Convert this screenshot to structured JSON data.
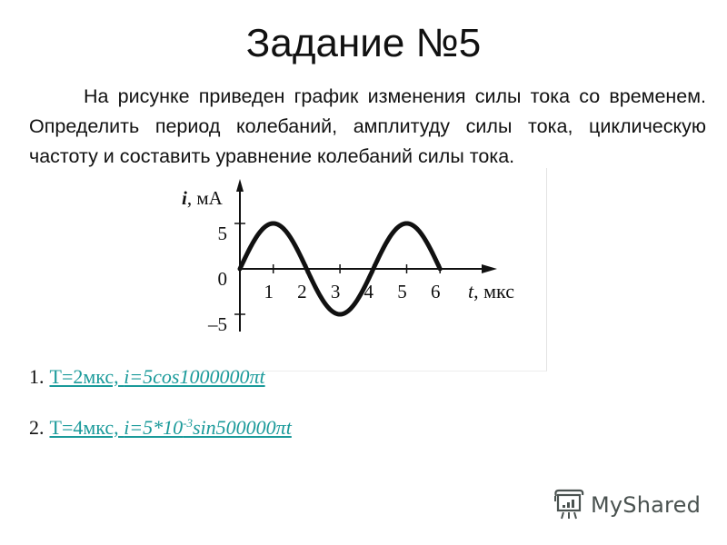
{
  "title": "Задание №5",
  "task_text": "На рисунке приведен график изменения силы тока со временем. Определить период колебаний, амплитуду силы тока, циклическую частоту и составить уравнение колебаний силы тока.",
  "answers": [
    {
      "number": "1.",
      "prefix": "T=2мкс, ",
      "formula": "i=5cos1000000πt",
      "formula_parts": {
        "pre": "",
        "base": "",
        "exp": "",
        "post": ""
      }
    },
    {
      "number": "2.",
      "prefix": "T=4мкс, ",
      "formula_parts": {
        "pre": "i=5*10",
        "exp": "-3",
        "post": "sin500000πt"
      }
    }
  ],
  "logo": {
    "text": "MyShared",
    "icon": "presentation-board-icon"
  },
  "colors": {
    "link": "#1a9a9a",
    "text": "#111111",
    "logo": "#4a5250"
  },
  "chart_data": {
    "type": "line",
    "title": "",
    "xlabel": "t, мкс",
    "ylabel": "i, мА",
    "xlim": [
      0,
      6
    ],
    "ylim": [
      -5,
      5
    ],
    "x_ticks": [
      1,
      2,
      3,
      4,
      5,
      6
    ],
    "x_tick_labels": [
      "1",
      "2",
      "3",
      "4",
      "5",
      "6"
    ],
    "y_ticks": [
      5,
      0,
      -5
    ],
    "y_tick_labels": [
      "5",
      "0",
      "–5"
    ],
    "grid": false,
    "legend": "none",
    "series": [
      {
        "name": "i(t)",
        "function": "5*sin(pi*t/2)",
        "amplitude": 5,
        "period": 4,
        "x": [
          0,
          0.5,
          1,
          1.5,
          2,
          2.5,
          3,
          3.5,
          4,
          4.5,
          5,
          5.5,
          6
        ],
        "y": [
          0,
          3.54,
          5,
          3.54,
          0,
          -3.54,
          -5,
          -3.54,
          0,
          3.54,
          5,
          3.54,
          0
        ]
      }
    ]
  }
}
